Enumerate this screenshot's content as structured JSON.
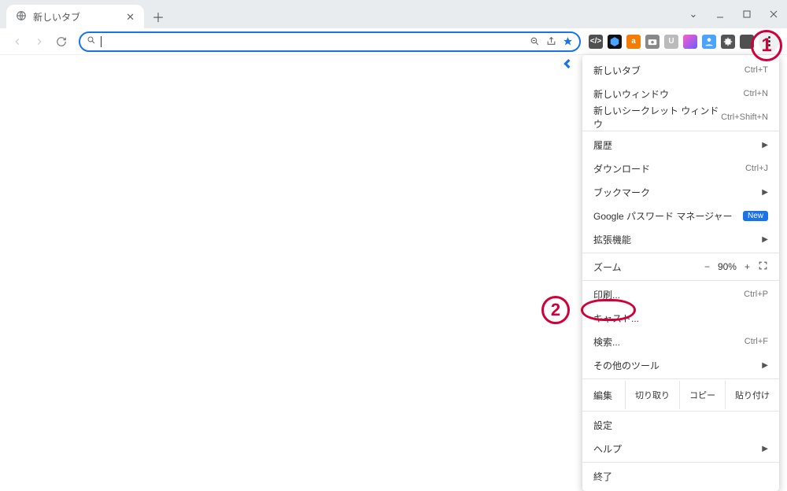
{
  "tab": {
    "title": "新しいタブ"
  },
  "window": {
    "chevron": "⌄"
  },
  "omnibox": {
    "placeholder": ""
  },
  "zoom_value": "90%",
  "menu": {
    "new_tab": {
      "label": "新しいタブ",
      "shortcut": "Ctrl+T"
    },
    "new_window": {
      "label": "新しいウィンドウ",
      "shortcut": "Ctrl+N"
    },
    "incognito": {
      "label": "新しいシークレット ウィンドウ",
      "shortcut": "Ctrl+Shift+N"
    },
    "history": {
      "label": "履歴"
    },
    "downloads": {
      "label": "ダウンロード",
      "shortcut": "Ctrl+J"
    },
    "bookmarks": {
      "label": "ブックマーク"
    },
    "pwd_mgr": {
      "label": "Google パスワード マネージャー",
      "badge": "New"
    },
    "extensions": {
      "label": "拡張機能"
    },
    "zoom": {
      "label": "ズーム"
    },
    "print": {
      "label": "印刷...",
      "shortcut": "Ctrl+P"
    },
    "cast": {
      "label": "キャスト..."
    },
    "find": {
      "label": "検索...",
      "shortcut": "Ctrl+F"
    },
    "more_tools": {
      "label": "その他のツール"
    },
    "edit": {
      "label": "編集",
      "cut": "切り取り",
      "copy": "コピー",
      "paste": "貼り付け"
    },
    "settings": {
      "label": "設定"
    },
    "help": {
      "label": "ヘルプ"
    },
    "exit": {
      "label": "終了"
    }
  },
  "annotations": {
    "one": "1",
    "two": "2"
  },
  "ext_icons": [
    "dev",
    "cube",
    "a",
    "cam",
    "u",
    "b",
    "p",
    "puz",
    "sq"
  ]
}
